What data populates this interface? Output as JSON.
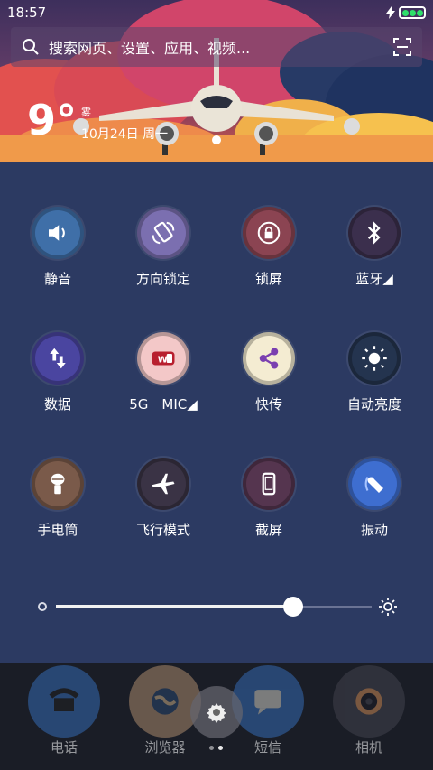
{
  "status_bar": {
    "time": "18:57",
    "icons": [
      "flash-icon",
      "battery-icon"
    ]
  },
  "search": {
    "placeholder": "搜索网页、设置、应用、视频..."
  },
  "weather": {
    "temperature": "9°",
    "condition": "雾",
    "date": "10月24日 周一"
  },
  "quick_settings": [
    {
      "label": "静音",
      "icon": "speaker-icon",
      "color": "#3f6fa8"
    },
    {
      "label": "方向锁定",
      "icon": "rotation-lock-icon",
      "color": "#7b6fb0"
    },
    {
      "label": "锁屏",
      "icon": "lock-icon",
      "color": "#8b4452"
    },
    {
      "label": "蓝牙◢",
      "icon": "bluetooth-icon",
      "color": "#3b2f4d"
    },
    {
      "label": "数据",
      "icon": "data-arrows-icon",
      "color": "#4a45a0"
    },
    {
      "label": "5G　MIC◢",
      "icon": "wifi-icon",
      "color": "#f3c8c8"
    },
    {
      "label": "快传",
      "icon": "share-icon",
      "color": "#f4ecd2"
    },
    {
      "label": "自动亮度",
      "icon": "sun-icon",
      "color": "#24344f"
    },
    {
      "label": "手电筒",
      "icon": "flashlight-icon",
      "color": "#7a5a4a"
    },
    {
      "label": "飞行模式",
      "icon": "airplane-icon",
      "color": "#3a3345"
    },
    {
      "label": "截屏",
      "icon": "screenshot-icon",
      "color": "#55354f"
    },
    {
      "label": "振动",
      "icon": "vibrate-icon",
      "color": "#3e6ed0"
    }
  ],
  "brightness": {
    "level": 0.75
  },
  "dock": [
    {
      "label": "电话",
      "icon": "phone-icon",
      "color": "#3a7bd0"
    },
    {
      "label": "浏览器",
      "icon": "browser-icon",
      "color": "#c8a07a"
    },
    {
      "label": "短信",
      "icon": "message-icon",
      "color": "#3a7bd0"
    },
    {
      "label": "相机",
      "icon": "camera-icon",
      "color": "#4a4a55"
    }
  ],
  "colors": {
    "panel_bg": "#2c3a62",
    "header_accent": "#d8644c",
    "battery_green": "#2ee06a"
  }
}
